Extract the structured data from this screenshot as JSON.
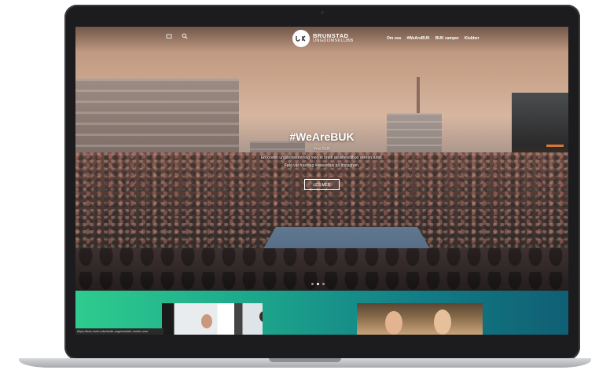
{
  "header": {
    "left_icons": [
      "window-icon",
      "search-icon"
    ],
    "logo": {
      "line1": "BRUNSTAD",
      "line2": "UNGDOMSKLUBB"
    },
    "nav": [
      "Om oss",
      "#WeAreBUK",
      "BUK camper",
      "Klubber"
    ]
  },
  "hero": {
    "title": "#WeAreBUK",
    "line1": "Vi er BUK",
    "line2": "En kristen ungdomsforening med et bredt aktivitetstilbud verden rundt.",
    "line3": "Følg vår hashtag #wearebuk på Instagram.",
    "button": "LES MER",
    "slide_count": 3,
    "active_slide": 1
  },
  "status": {
    "url": "https://buk.no/en-strekede-ungdomsleir-venter-oss/"
  },
  "colors": {
    "accent_green": "#2ecc8e",
    "accent_teal": "#0f5f73"
  }
}
